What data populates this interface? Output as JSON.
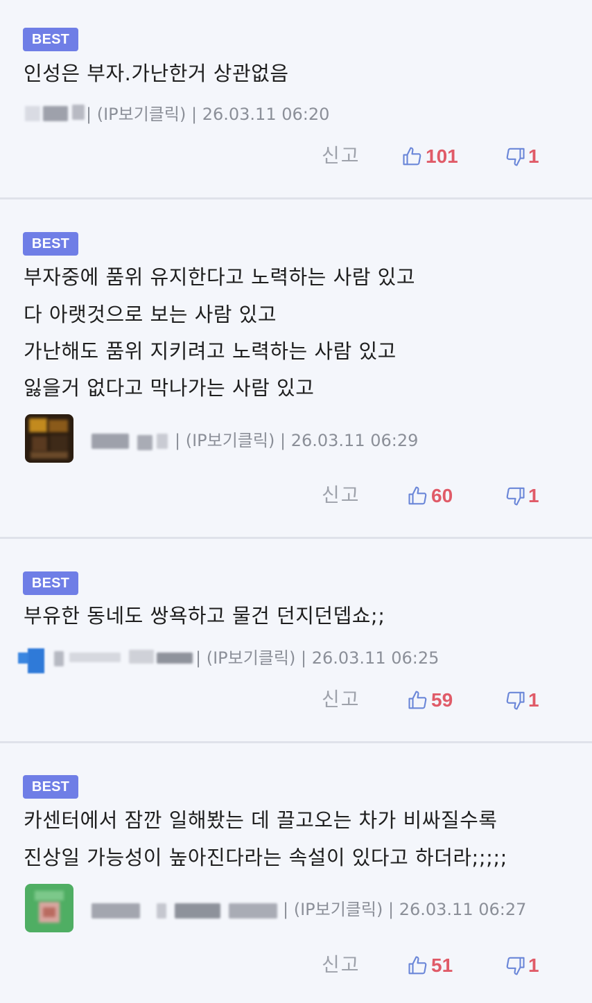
{
  "comments": [
    {
      "badge": "BEST",
      "lines": [
        "인성은 부자.가난한거 상관없음"
      ],
      "ip_link": "(IP보기클릭)",
      "timestamp": "26.03.11 06:20",
      "report_label": "신고",
      "likes": "101",
      "dislikes": "1"
    },
    {
      "badge": "BEST",
      "lines": [
        "부자중에 품위 유지한다고 노력하는 사람 있고",
        "다 아랫것으로 보는 사람 있고",
        "가난해도 품위 지키려고  노력하는 사람 있고",
        "잃을거 없다고 막나가는 사람 있고"
      ],
      "ip_link": "(IP보기클릭)",
      "timestamp": "26.03.11 06:29",
      "report_label": "신고",
      "likes": "60",
      "dislikes": "1"
    },
    {
      "badge": "BEST",
      "lines": [
        "부유한 동네도 쌍욕하고 물건 던지던뎁쇼;;"
      ],
      "ip_link": "(IP보기클릭)",
      "timestamp": "26.03.11 06:25",
      "report_label": "신고",
      "likes": "59",
      "dislikes": "1"
    },
    {
      "badge": "BEST",
      "lines": [
        "카센터에서 잠깐 일해봤는 데 끌고오는 차가 비싸질수록",
        "진상일 가능성이 높아진다라는 속설이 있다고 하더라;;;;;"
      ],
      "ip_link": "(IP보기클릭)",
      "timestamp": "26.03.11 06:27",
      "report_label": "신고",
      "likes": "51",
      "dislikes": "1"
    }
  ],
  "separator": "|",
  "icons": {
    "like": "thumbs-up-icon",
    "dislike": "thumbs-down-icon"
  },
  "colors": {
    "badge": "#6f7ee6",
    "vote_count": "#e05b68",
    "vote_icon": "#6a86d8",
    "meta_text": "#8b8f98",
    "background": "#f4f6fb"
  }
}
